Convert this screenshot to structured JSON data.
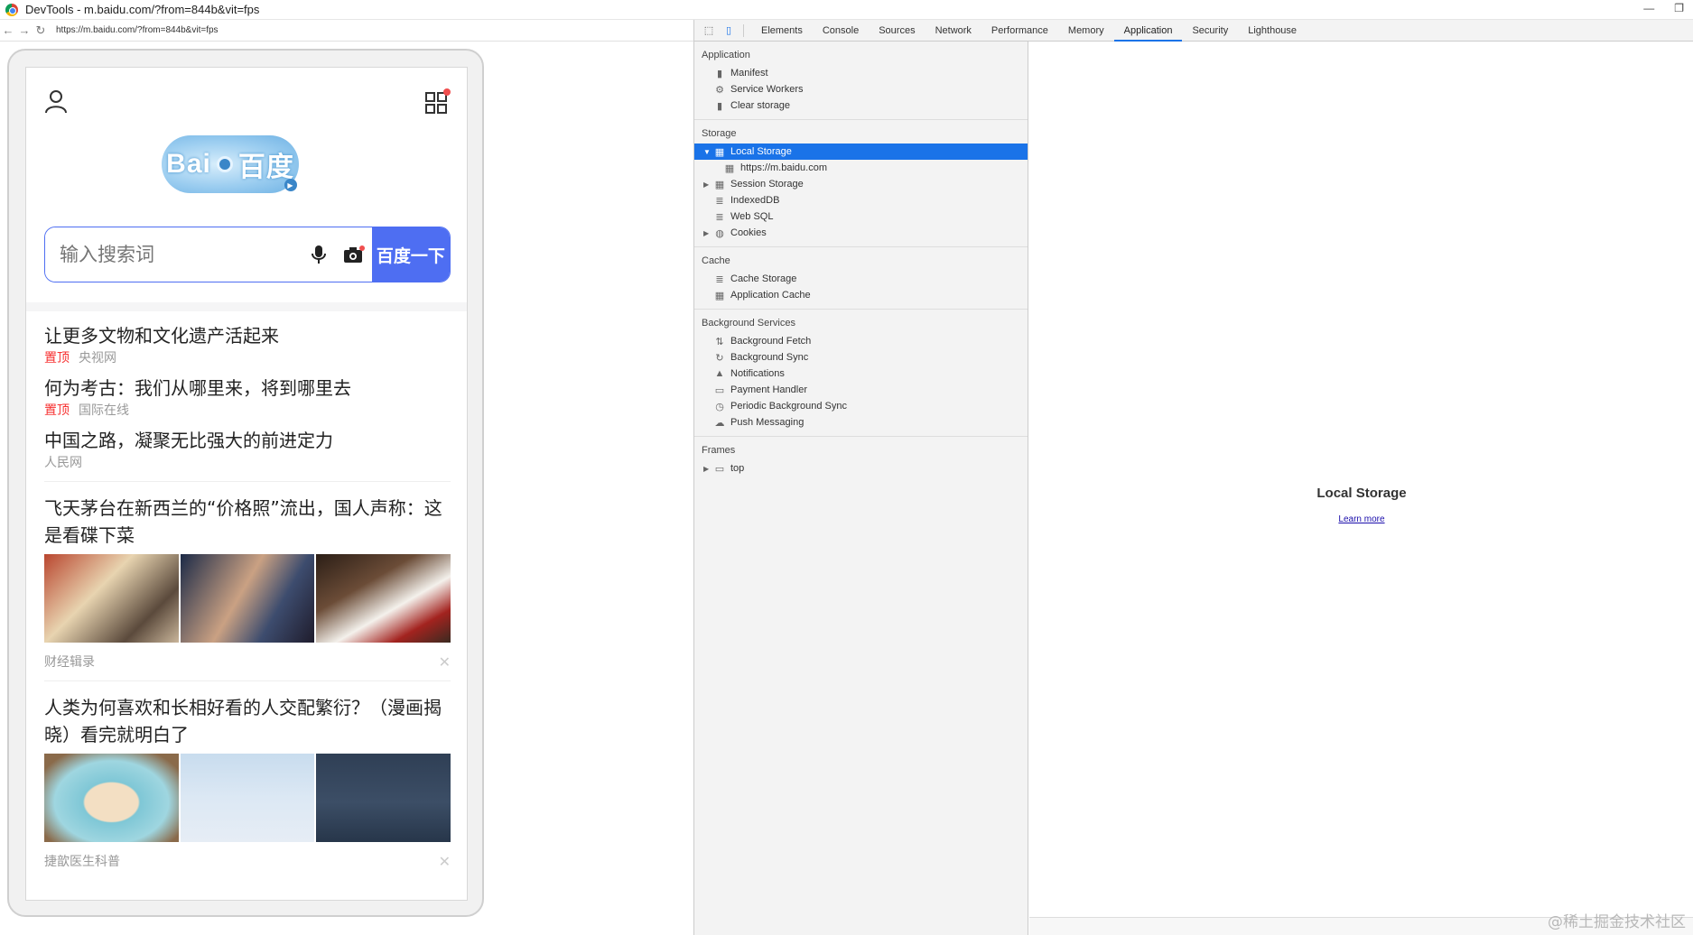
{
  "window": {
    "title": "DevTools - m.baidu.com/?from=844b&vit=fps"
  },
  "browser": {
    "url": "https://m.baidu.com/?from=844b&vit=fps"
  },
  "page": {
    "logo_text_left": "Bai",
    "logo_text_right": "百度",
    "search": {
      "placeholder": "输入搜索词",
      "button": "百度一下"
    },
    "hot": [
      {
        "title": "让更多文物和文化遗产活起来",
        "tag": "置顶",
        "source": "央视网"
      },
      {
        "title": "何为考古：我们从哪里来，将到哪里去",
        "tag": "置顶",
        "source": "国际在线"
      },
      {
        "title": "中国之路，凝聚无比强大的前进定力",
        "tag": "",
        "source": "人民网"
      }
    ],
    "feed": [
      {
        "title": "飞天茅台在新西兰的“价格照”流出，国人声称：这是看碟下菜",
        "source": "财经辑录"
      },
      {
        "title": "人类为何喜欢和长相好看的人交配繁衍？（漫画揭晓）看完就明白了",
        "source": "捷歆医生科普"
      }
    ]
  },
  "devtools": {
    "tabs": [
      "Elements",
      "Console",
      "Sources",
      "Network",
      "Performance",
      "Memory",
      "Application",
      "Security",
      "Lighthouse"
    ],
    "active_tab": "Application",
    "sections": {
      "application": {
        "title": "Application",
        "items": [
          "Manifest",
          "Service Workers",
          "Clear storage"
        ]
      },
      "storage": {
        "title": "Storage",
        "items": [
          "Local Storage",
          "https://m.baidu.com",
          "Session Storage",
          "IndexedDB",
          "Web SQL",
          "Cookies"
        ]
      },
      "cache": {
        "title": "Cache",
        "items": [
          "Cache Storage",
          "Application Cache"
        ]
      },
      "background": {
        "title": "Background Services",
        "items": [
          "Background Fetch",
          "Background Sync",
          "Notifications",
          "Payment Handler",
          "Periodic Background Sync",
          "Push Messaging"
        ]
      },
      "frames": {
        "title": "Frames",
        "items": [
          "top"
        ]
      }
    },
    "main": {
      "heading": "Local Storage",
      "link": "Learn more"
    },
    "colors": {
      "selected": "#1a73e8",
      "baidu_blue": "#4e6ef2",
      "top_red": "#f73131"
    }
  },
  "watermark": "@稀土掘金技术社区"
}
